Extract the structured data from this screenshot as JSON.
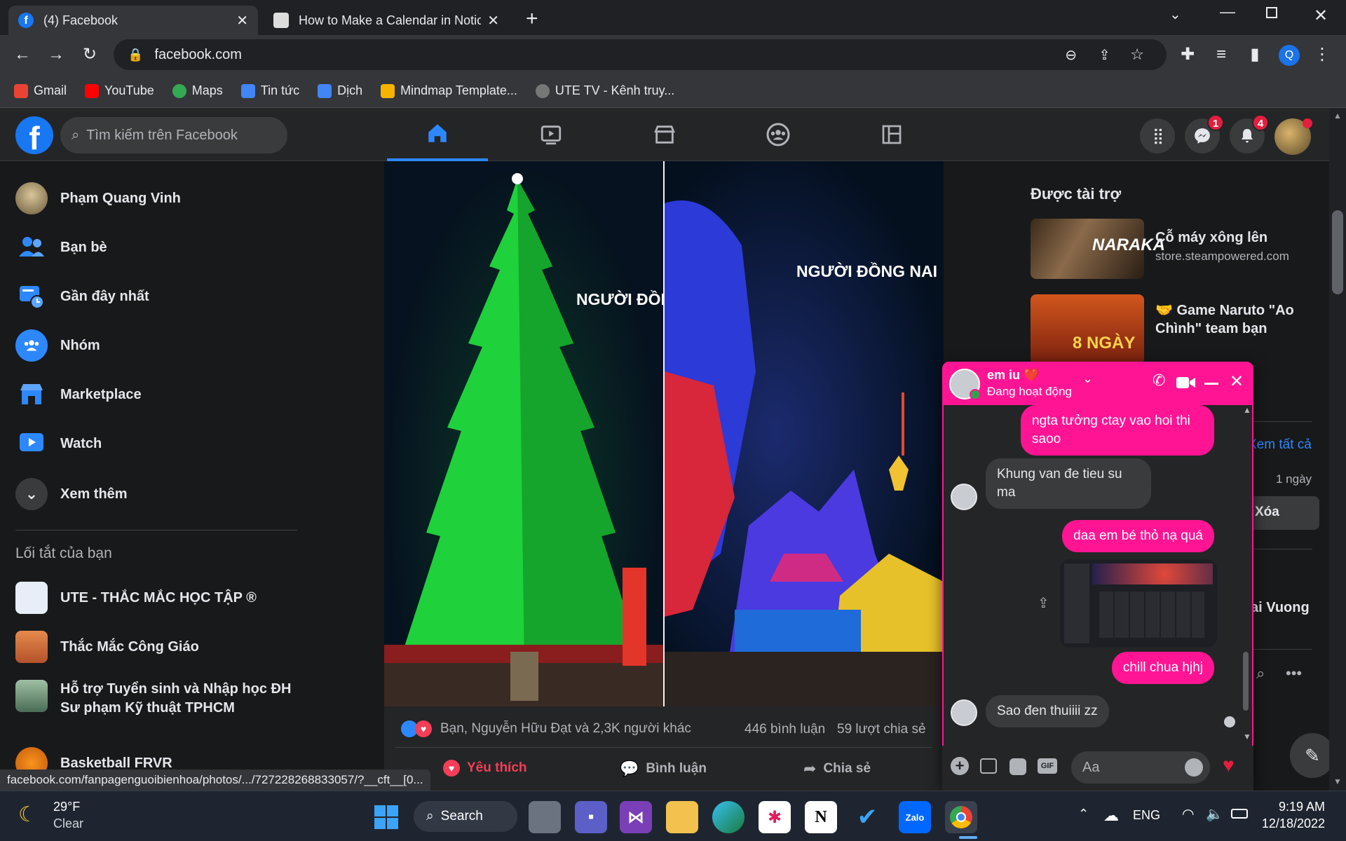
{
  "browser": {
    "tabs": [
      {
        "title": "(4) Facebook",
        "active": true
      },
      {
        "title": "How to Make a Calendar in Notic",
        "active": false
      }
    ],
    "url": "facebook.com",
    "bookmarks": [
      "Gmail",
      "YouTube",
      "Maps",
      "Tin tức",
      "Dịch",
      "Mindmap Template...",
      "UTE TV - Kênh truy..."
    ],
    "profile_initial": "Q",
    "status_url": "facebook.com/fanpagenguoibienhoa/photos/.../727228268833057/?__cft__[0..."
  },
  "fb": {
    "search_placeholder": "Tìm kiếm trên Facebook",
    "messenger_badge": "1",
    "notif_badge": "4"
  },
  "sidebar": {
    "user": "Phạm Quang Vinh",
    "items": [
      "Bạn bè",
      "Gần đây nhất",
      "Nhóm",
      "Marketplace",
      "Watch",
      "Xem thêm"
    ],
    "shortcuts_title": "Lối tắt của bạn",
    "shortcuts": [
      "UTE - THẮC MẮC HỌC TẬP ®",
      "Thắc Mắc Công Giáo",
      "Hỗ trợ Tuyển sinh và Nhập học ĐH Sư phạm Kỹ thuật TPHCM",
      "Basketball FRVR"
    ]
  },
  "post": {
    "overlay_left": "NGƯỜI ĐỒN",
    "overlay_right": "NGƯỜI ĐỒNG NAI",
    "reactions": "Bạn, Nguyễn Hữu Đạt và 2,3K người khác",
    "comments": "446 bình luận",
    "shares": "59 lượt chia sẻ",
    "like_label": "Yêu thích",
    "comment_label": "Bình luận",
    "share_label": "Chia sẻ"
  },
  "sponsored": {
    "title": "Được tài trợ",
    "ads": [
      {
        "name": "Cỗ máy xông lên",
        "domain": "store.steampowered.com"
      },
      {
        "name": "🤝 Game Naruto \"Ao Chình\" team bạn",
        "domain": ""
      }
    ],
    "see_all": "Xem tất cả",
    "time": "1 ngày",
    "delete": "Xóa",
    "contact": "ai Vuong"
  },
  "chat": {
    "name": "em iu ❤️",
    "status": "Đang hoạt động",
    "messages": [
      {
        "from": "me",
        "text": "ngta tưởng ctay vao hoi thi saoo"
      },
      {
        "from": "them",
        "text": "Khung van đe tieu su ma"
      },
      {
        "from": "me",
        "text": "daa em bé thỏ nạ quá"
      },
      {
        "from": "me",
        "text": "chill chua hjhj"
      },
      {
        "from": "them",
        "text": "Sao đen thuiiii zz"
      }
    ],
    "input_placeholder": "Aa"
  },
  "taskbar": {
    "weather_temp": "29°F",
    "weather_desc": "Clear",
    "search_label": "Search",
    "lang": "ENG",
    "time": "9:19 AM",
    "date": "12/18/2022"
  }
}
